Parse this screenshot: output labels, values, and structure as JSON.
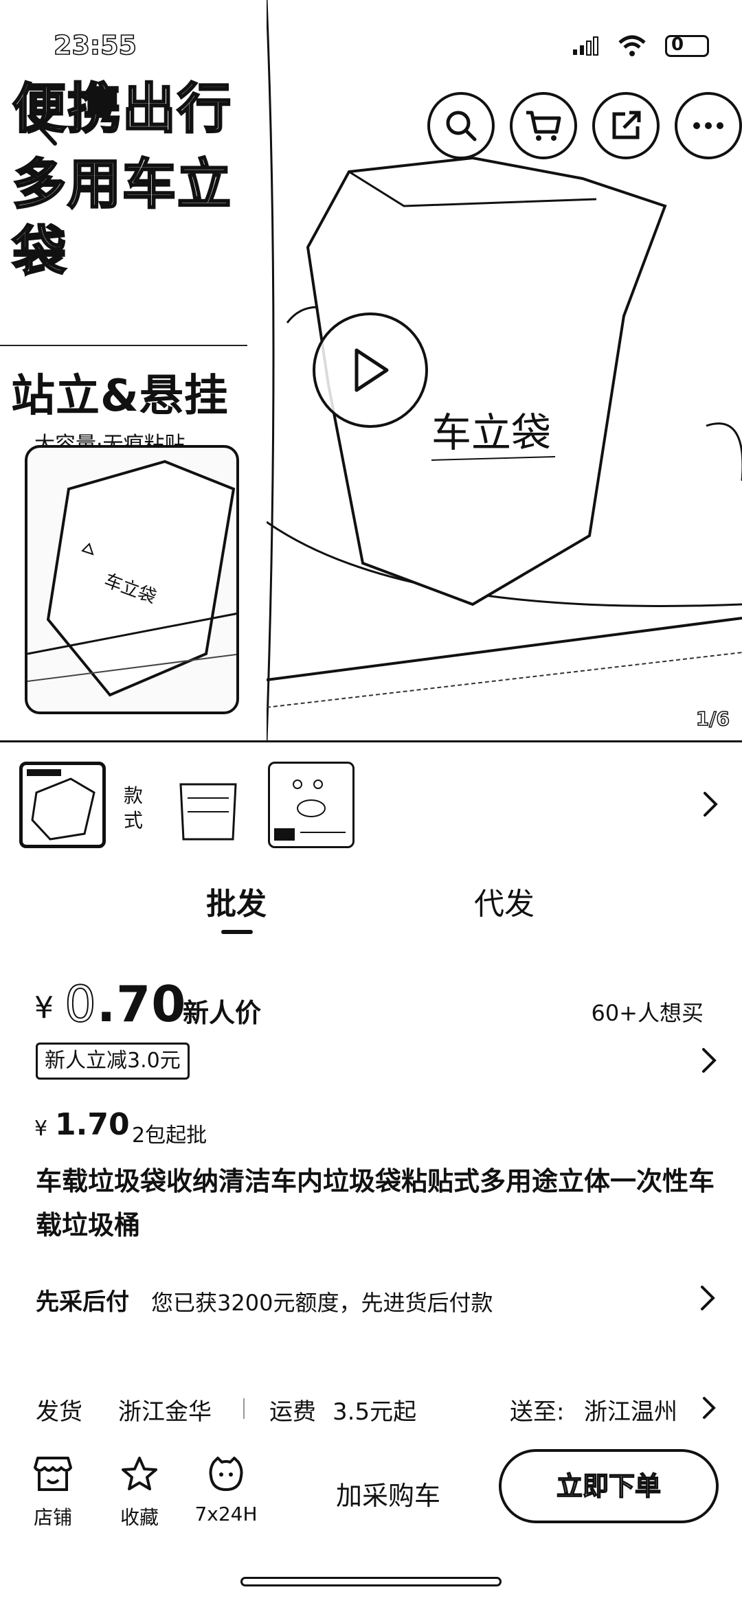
{
  "status_bar": {
    "time": "23:55",
    "battery": "0"
  },
  "hero": {
    "promo_line1": "便携出行",
    "promo_line2": "多用车立袋",
    "promo_heading": "站立&悬挂",
    "promo_sub": "大容量·无痕粘贴",
    "bag_brand": "车立袋",
    "counter": "1/6"
  },
  "style_selector": {
    "label": "款式"
  },
  "tabs": [
    {
      "label": "批发",
      "active": true
    },
    {
      "label": "代发",
      "active": false
    }
  ],
  "price": {
    "currency": "¥",
    "value_int": "0",
    "value_dec": ".70",
    "tag": "新人价",
    "wants": "60+人想买"
  },
  "coupon": {
    "label": "新人立减3.0元"
  },
  "bulk": {
    "currency": "¥",
    "price": "1.70",
    "min_order": "2包起批"
  },
  "product": {
    "title": "车载垃圾袋收纳清洁车内垃圾袋粘贴式多用途立体一次性车载垃圾桶"
  },
  "credit": {
    "label": "先采后付",
    "text": "您已获3200元额度，先进货后付款"
  },
  "shipping": {
    "label": "发货",
    "origin": "浙江金华",
    "fee_label": "运费",
    "fee": "3.5元起",
    "dest_label": "送至:",
    "dest": "浙江温州"
  },
  "bottom_bar": {
    "shop": "店铺",
    "favorite": "收藏",
    "service": "7x24H",
    "add_cart": "加采购车",
    "buy_now": "立即下单"
  }
}
